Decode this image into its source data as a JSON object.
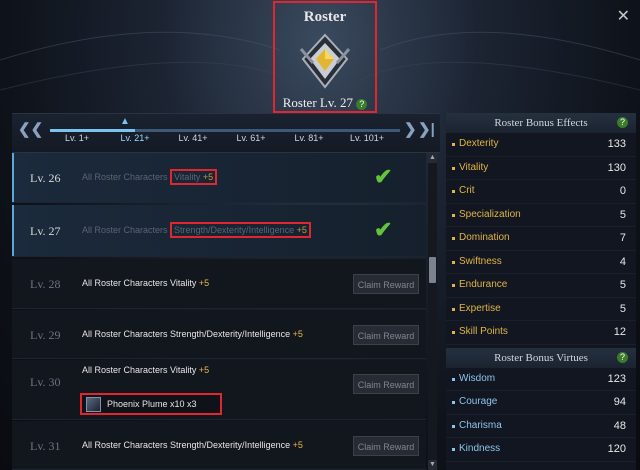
{
  "header": {
    "title": "Roster",
    "level_label": "Roster Lv. 27",
    "help_glyph": "?"
  },
  "close_glyph": "✕",
  "progress": {
    "prev_glyph": "❮",
    "first_glyph": "❮❮",
    "next_glyph": "❯",
    "last_glyph": "❯❯",
    "ticks": [
      "Lv. 1+",
      "Lv. 21+",
      "Lv. 41+",
      "Lv. 61+",
      "Lv. 81+",
      "Lv. 101+"
    ],
    "current_tick_index": 1
  },
  "rows": [
    {
      "level": "Lv. 26",
      "desc": "All Roster Characters Vitality",
      "bonus": "+5",
      "status": "completed"
    },
    {
      "level": "Lv. 27",
      "desc": "All Roster Characters Strength/Dexterity/Intelligence",
      "bonus": "+5",
      "status": "completed"
    },
    {
      "level": "Lv. 28",
      "desc": "All Roster Characters Vitality",
      "bonus": "+5",
      "status": "locked",
      "button": "Claim Reward"
    },
    {
      "level": "Lv. 29",
      "desc": "All Roster Characters Strength/Dexterity/Intelligence",
      "bonus": "+5",
      "status": "locked",
      "button": "Claim Reward"
    },
    {
      "level": "Lv. 30",
      "desc": "All Roster Characters Vitality",
      "bonus": "+5",
      "status": "locked",
      "button": "Claim Reward",
      "reward_item": "Phoenix Plume x10 x3"
    },
    {
      "level": "Lv. 31",
      "desc": "All Roster Characters Strength/Dexterity/Intelligence",
      "bonus": "+5",
      "status": "locked",
      "button": "Claim Reward"
    }
  ],
  "check_glyph": "✔",
  "bonus_effects": {
    "title": "Roster Bonus Effects",
    "stats": [
      {
        "name": "Dexterity",
        "value": "133"
      },
      {
        "name": "Vitality",
        "value": "130"
      },
      {
        "name": "Crit",
        "value": "0"
      },
      {
        "name": "Specialization",
        "value": "5"
      },
      {
        "name": "Domination",
        "value": "7"
      },
      {
        "name": "Swiftness",
        "value": "4"
      },
      {
        "name": "Endurance",
        "value": "5"
      },
      {
        "name": "Expertise",
        "value": "5"
      },
      {
        "name": "Skill Points",
        "value": "12"
      }
    ]
  },
  "bonus_virtues": {
    "title": "Roster Bonus Virtues",
    "stats": [
      {
        "name": "Wisdom",
        "value": "123"
      },
      {
        "name": "Courage",
        "value": "94"
      },
      {
        "name": "Charisma",
        "value": "48"
      },
      {
        "name": "Kindness",
        "value": "120"
      }
    ]
  },
  "colors": {
    "accent_red": "#e0262f",
    "gold": "#e2b446",
    "blue": "#8ec4ec",
    "check_green": "#63c43a"
  }
}
